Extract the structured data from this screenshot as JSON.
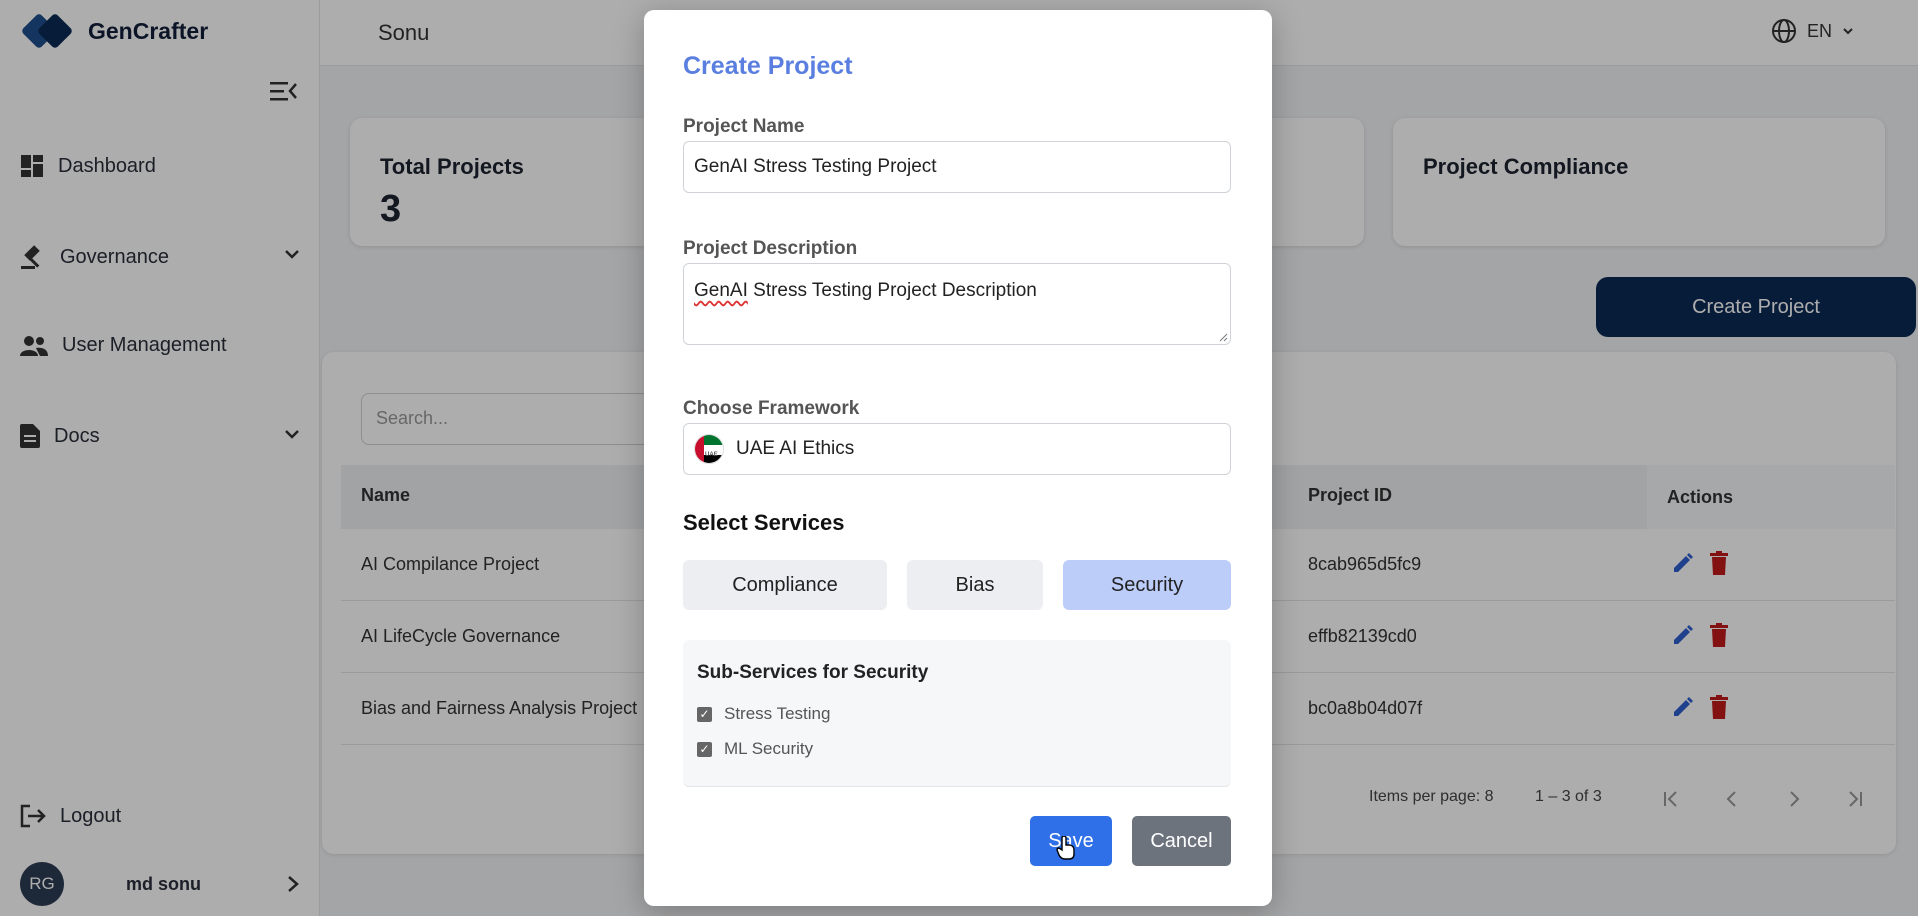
{
  "app": {
    "name": "GenCrafter"
  },
  "header": {
    "user_title": "Sonu",
    "language": "EN"
  },
  "sidebar": {
    "items": [
      {
        "label": "Dashboard",
        "icon": "dashboard-icon"
      },
      {
        "label": "Governance",
        "icon": "gavel-icon"
      },
      {
        "label": "User Management",
        "icon": "users-icon"
      },
      {
        "label": "Docs",
        "icon": "document-icon"
      }
    ],
    "logout": "Logout",
    "user": {
      "initials": "RG",
      "name": "md sonu"
    }
  },
  "stats": {
    "total_projects_label": "Total Projects",
    "total_projects_value": "3",
    "compliance_label": "Project Compliance"
  },
  "create_button": "Create Project",
  "search": {
    "placeholder": "Search..."
  },
  "table": {
    "columns": {
      "name": "Name",
      "project_id": "Project ID",
      "actions": "Actions"
    },
    "rows": [
      {
        "name": "AI Compilance Project",
        "id": "8cab965d5fc9"
      },
      {
        "name": "AI LifeCycle Governance",
        "id": "effb82139cd0"
      },
      {
        "name": "Bias and Fairness Analysis Project",
        "id": "bc0a8b04d07f"
      }
    ],
    "items_per_page": "Items per page: 8",
    "range": "1 – 3 of 3"
  },
  "modal": {
    "title": "Create Project",
    "name_label": "Project Name",
    "name_value": "GenAI Stress Testing Project",
    "desc_label": "Project Description",
    "desc_value_misspelled": "GenAI",
    "desc_value_rest": " Stress Testing Project Description",
    "framework_label": "Choose Framework",
    "framework_value": "UAE AI Ethics",
    "flag_text": "UAE",
    "services_label": "Select Services",
    "services": [
      "Compliance",
      "Bias",
      "Security"
    ],
    "active_service": "Security",
    "sub_title": "Sub-Services for Security",
    "sub_services": [
      "Stress Testing",
      "ML Security"
    ],
    "save": "Save",
    "cancel": "Cancel"
  },
  "colors": {
    "accent": "#2f6fe8",
    "brand_dark": "#0b2a55",
    "title": "#5a7fe0",
    "delete": "#c21a1a"
  }
}
